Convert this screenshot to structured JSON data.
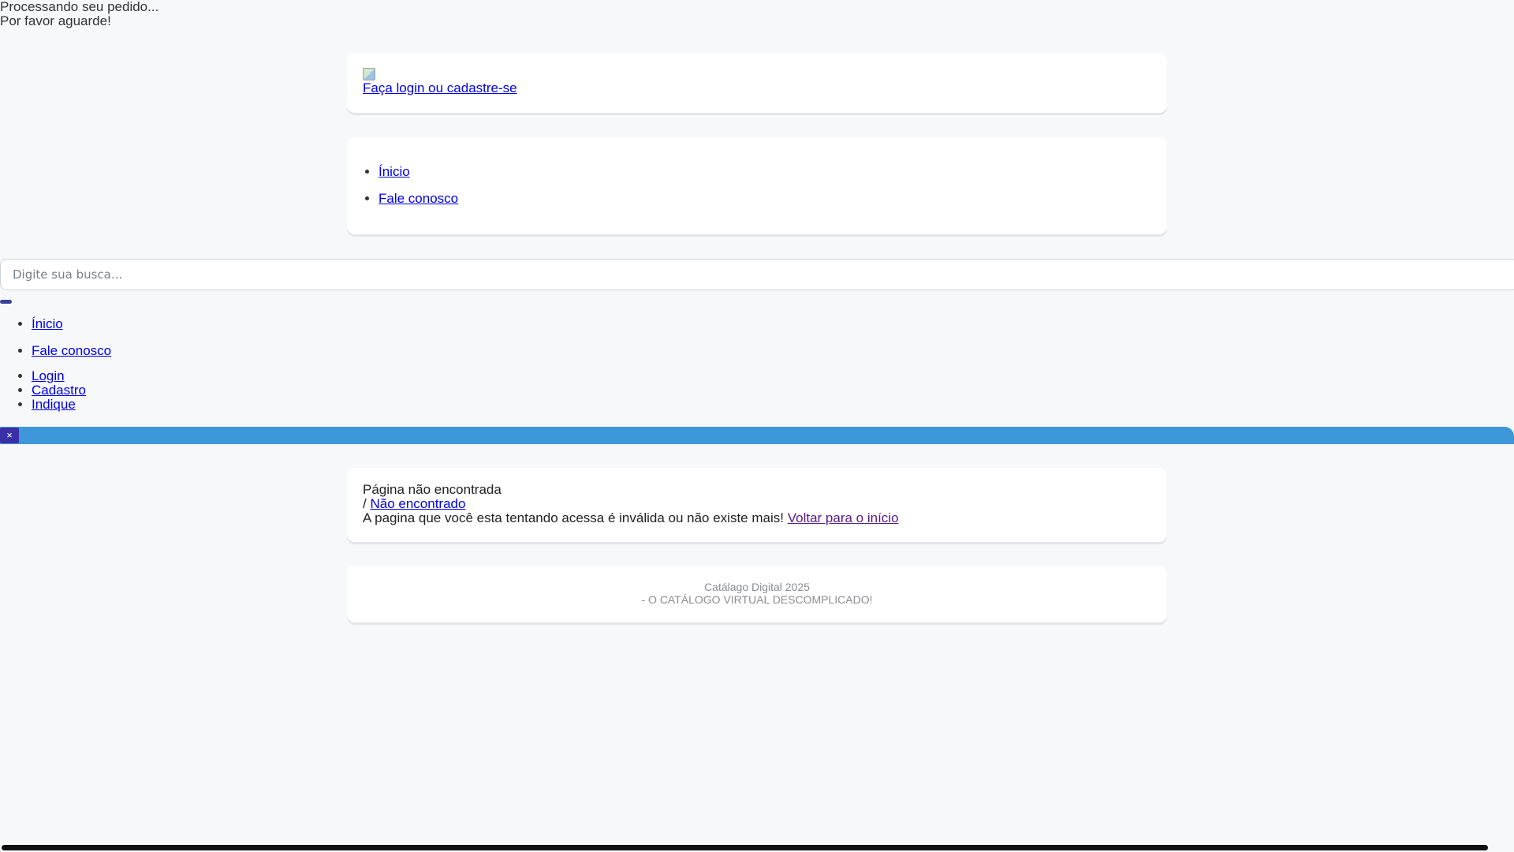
{
  "loading": {
    "line1": "Processando seu pedido...",
    "line2": "Por favor aguarde!"
  },
  "login_card": {
    "logo_icon": "broken-image-icon",
    "link": "Faça login ou cadastre-se"
  },
  "nav": {
    "items": [
      "Ínicio",
      "Fale conosco"
    ]
  },
  "search": {
    "placeholder": "Digite sua busca..."
  },
  "mobile_nav": {
    "items": [
      "Ínicio",
      "Fale conosco"
    ],
    "account": [
      "Login",
      "Cadastro",
      "Indique"
    ]
  },
  "banner": {
    "close_label": "×",
    "color": "#3d97d9"
  },
  "error_card": {
    "title": "Página não encontrada",
    "crumb_separator": "/",
    "crumb_link": "Não encontrado",
    "message": "A pagina que você esta tentando acessa é inválida ou não existe mais!",
    "back_link": "Voltar para o início"
  },
  "footer": {
    "line1": "Catálago Digital 2025",
    "line2": "- O CATÁLOGO VIRTUAL DESCOMPLICADO!"
  }
}
